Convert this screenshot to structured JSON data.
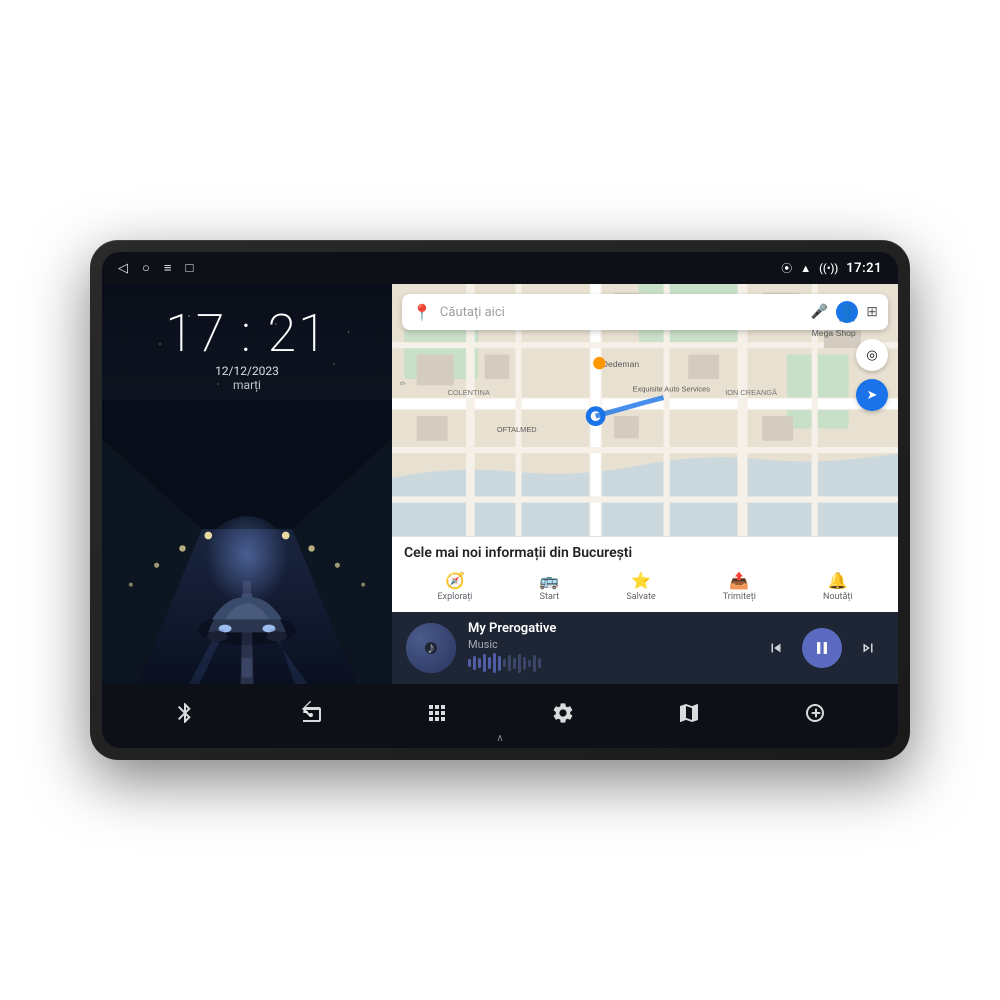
{
  "device": {
    "shell_label": "Car Head Unit"
  },
  "status_bar": {
    "nav_back": "◁",
    "nav_home": "○",
    "nav_menu": "≡",
    "nav_screenshot": "□",
    "bluetooth_icon": "bluetooth",
    "wifi_icon": "wifi",
    "time": "17:21",
    "signal_icon": "signal"
  },
  "lock_screen": {
    "time": "17 : 21",
    "date": "12/12/2023",
    "day": "marți"
  },
  "map": {
    "search_placeholder": "Căutați aici",
    "info_title": "Cele mai noi informații din București",
    "tabs": [
      {
        "icon": "🧭",
        "label": "Explorați"
      },
      {
        "icon": "🚌",
        "label": "Start"
      },
      {
        "icon": "⭐",
        "label": "Salvate"
      },
      {
        "icon": "📤",
        "label": "Trimiteți"
      },
      {
        "icon": "🔔",
        "label": "Noutăți"
      }
    ]
  },
  "music": {
    "title": "My Prerogative",
    "subtitle": "Music",
    "album_art_icon": "♪",
    "waveform_bars": [
      8,
      14,
      10,
      18,
      12,
      20,
      15,
      8,
      16,
      11,
      19,
      13,
      7,
      17,
      10
    ],
    "ctrl_prev": "⏮",
    "ctrl_play": "⏸",
    "ctrl_next": "⏭"
  },
  "bottom_nav": [
    {
      "icon": "⁂",
      "label": "bluetooth",
      "symbol": "✱"
    },
    {
      "icon": "📻",
      "label": "radio"
    },
    {
      "icon": "⊞",
      "label": "apps"
    },
    {
      "icon": "⚙",
      "label": "settings"
    },
    {
      "icon": "🗺",
      "label": "maps"
    },
    {
      "icon": "🎲",
      "label": "extra"
    }
  ]
}
